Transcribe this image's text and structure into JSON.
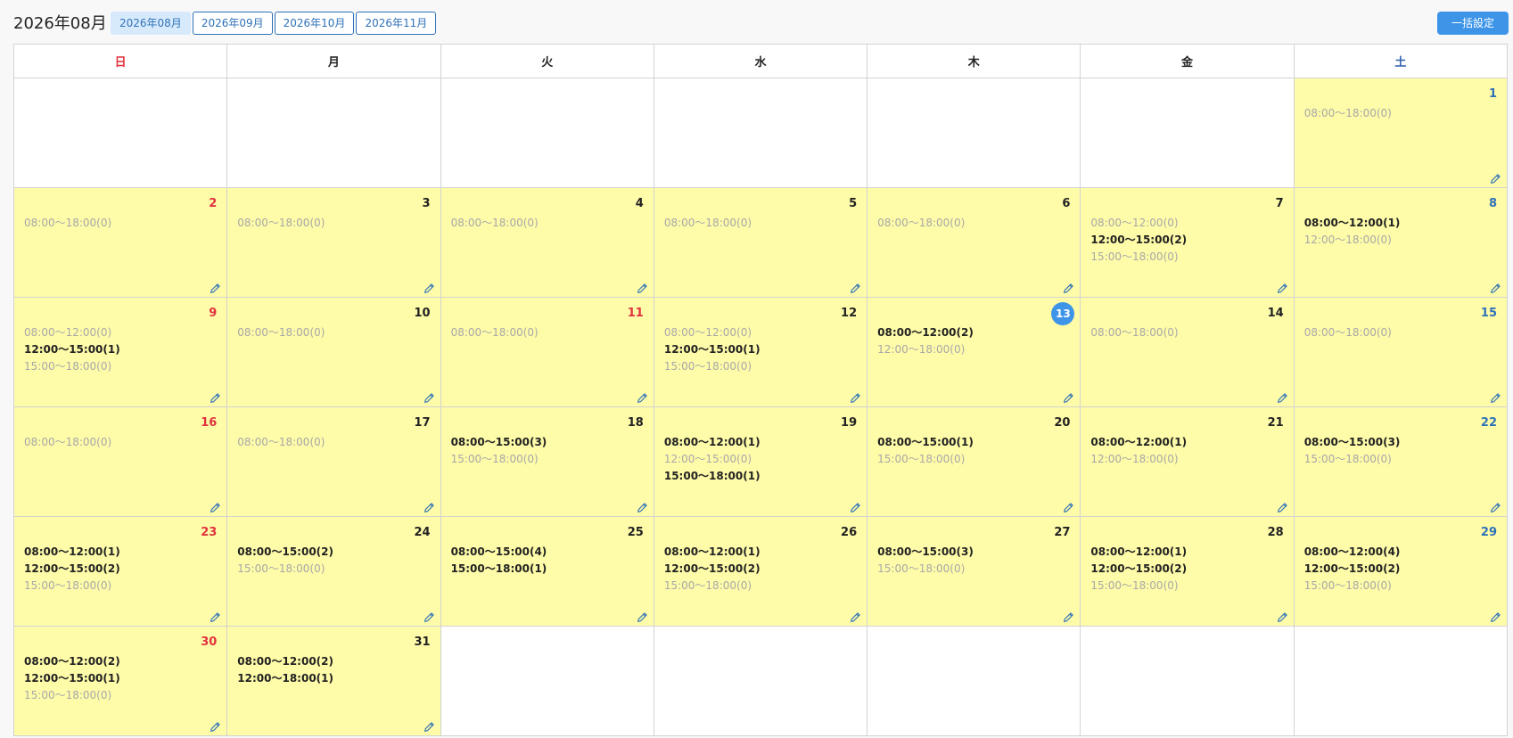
{
  "header": {
    "month_title": "2026年08月",
    "month_tabs": [
      {
        "label": "2026年08月",
        "active": true
      },
      {
        "label": "2026年09月",
        "active": false
      },
      {
        "label": "2026年10月",
        "active": false
      },
      {
        "label": "2026年11月",
        "active": false
      }
    ],
    "bulk_button_label": "一括設定"
  },
  "colors": {
    "accent": "#3e95e8",
    "filled_day_bg": "#fefba9",
    "sunday": "#e0323e",
    "saturday": "#2f72b8",
    "empty_slot_text": "#a8a8a8"
  },
  "calendar": {
    "weekdays": [
      "日",
      "月",
      "火",
      "水",
      "木",
      "金",
      "土"
    ],
    "today": 13,
    "weeks": [
      [
        null,
        null,
        null,
        null,
        null,
        null,
        {
          "day": 1,
          "type": "sat",
          "slots": [
            "08:00〜18:00(0)"
          ]
        }
      ],
      [
        {
          "day": 2,
          "type": "sun",
          "slots": [
            "08:00〜18:00(0)"
          ]
        },
        {
          "day": 3,
          "type": "",
          "slots": [
            "08:00〜18:00(0)"
          ]
        },
        {
          "day": 4,
          "type": "",
          "slots": [
            "08:00〜18:00(0)"
          ]
        },
        {
          "day": 5,
          "type": "",
          "slots": [
            "08:00〜18:00(0)"
          ]
        },
        {
          "day": 6,
          "type": "",
          "slots": [
            "08:00〜18:00(0)"
          ]
        },
        {
          "day": 7,
          "type": "",
          "slots": [
            "08:00〜12:00(0)",
            "12:00〜15:00(2)",
            "15:00〜18:00(0)"
          ]
        },
        {
          "day": 8,
          "type": "sat",
          "slots": [
            "08:00〜12:00(1)",
            "12:00〜18:00(0)"
          ]
        }
      ],
      [
        {
          "day": 9,
          "type": "sun",
          "slots": [
            "08:00〜12:00(0)",
            "12:00〜15:00(1)",
            "15:00〜18:00(0)"
          ]
        },
        {
          "day": 10,
          "type": "",
          "slots": [
            "08:00〜18:00(0)"
          ]
        },
        {
          "day": 11,
          "type": "holiday",
          "slots": [
            "08:00〜18:00(0)"
          ]
        },
        {
          "day": 12,
          "type": "",
          "slots": [
            "08:00〜12:00(0)",
            "12:00〜15:00(1)",
            "15:00〜18:00(0)"
          ]
        },
        {
          "day": 13,
          "type": "today",
          "slots": [
            "08:00〜12:00(2)",
            "12:00〜18:00(0)"
          ]
        },
        {
          "day": 14,
          "type": "",
          "slots": [
            "08:00〜18:00(0)"
          ]
        },
        {
          "day": 15,
          "type": "sat",
          "slots": [
            "08:00〜18:00(0)"
          ]
        }
      ],
      [
        {
          "day": 16,
          "type": "sun",
          "slots": [
            "08:00〜18:00(0)"
          ]
        },
        {
          "day": 17,
          "type": "",
          "slots": [
            "08:00〜18:00(0)"
          ]
        },
        {
          "day": 18,
          "type": "",
          "slots": [
            "08:00〜15:00(3)",
            "15:00〜18:00(0)"
          ]
        },
        {
          "day": 19,
          "type": "",
          "slots": [
            "08:00〜12:00(1)",
            "12:00〜15:00(0)",
            "15:00〜18:00(1)"
          ]
        },
        {
          "day": 20,
          "type": "",
          "slots": [
            "08:00〜15:00(1)",
            "15:00〜18:00(0)"
          ]
        },
        {
          "day": 21,
          "type": "",
          "slots": [
            "08:00〜12:00(1)",
            "12:00〜18:00(0)"
          ]
        },
        {
          "day": 22,
          "type": "sat",
          "slots": [
            "08:00〜15:00(3)",
            "15:00〜18:00(0)"
          ]
        }
      ],
      [
        {
          "day": 23,
          "type": "sun",
          "slots": [
            "08:00〜12:00(1)",
            "12:00〜15:00(2)",
            "15:00〜18:00(0)"
          ]
        },
        {
          "day": 24,
          "type": "",
          "slots": [
            "08:00〜15:00(2)",
            "15:00〜18:00(0)"
          ]
        },
        {
          "day": 25,
          "type": "",
          "slots": [
            "08:00〜15:00(4)",
            "15:00〜18:00(1)"
          ]
        },
        {
          "day": 26,
          "type": "",
          "slots": [
            "08:00〜12:00(1)",
            "12:00〜15:00(2)",
            "15:00〜18:00(0)"
          ]
        },
        {
          "day": 27,
          "type": "",
          "slots": [
            "08:00〜15:00(3)",
            "15:00〜18:00(0)"
          ]
        },
        {
          "day": 28,
          "type": "",
          "slots": [
            "08:00〜12:00(1)",
            "12:00〜15:00(2)",
            "15:00〜18:00(0)"
          ]
        },
        {
          "day": 29,
          "type": "sat",
          "slots": [
            "08:00〜12:00(4)",
            "12:00〜15:00(2)",
            "15:00〜18:00(0)"
          ]
        }
      ],
      [
        {
          "day": 30,
          "type": "sun",
          "slots": [
            "08:00〜12:00(2)",
            "12:00〜15:00(1)",
            "15:00〜18:00(0)"
          ]
        },
        {
          "day": 31,
          "type": "",
          "slots": [
            "08:00〜12:00(2)",
            "12:00〜18:00(1)"
          ]
        },
        null,
        null,
        null,
        null,
        null
      ]
    ]
  }
}
